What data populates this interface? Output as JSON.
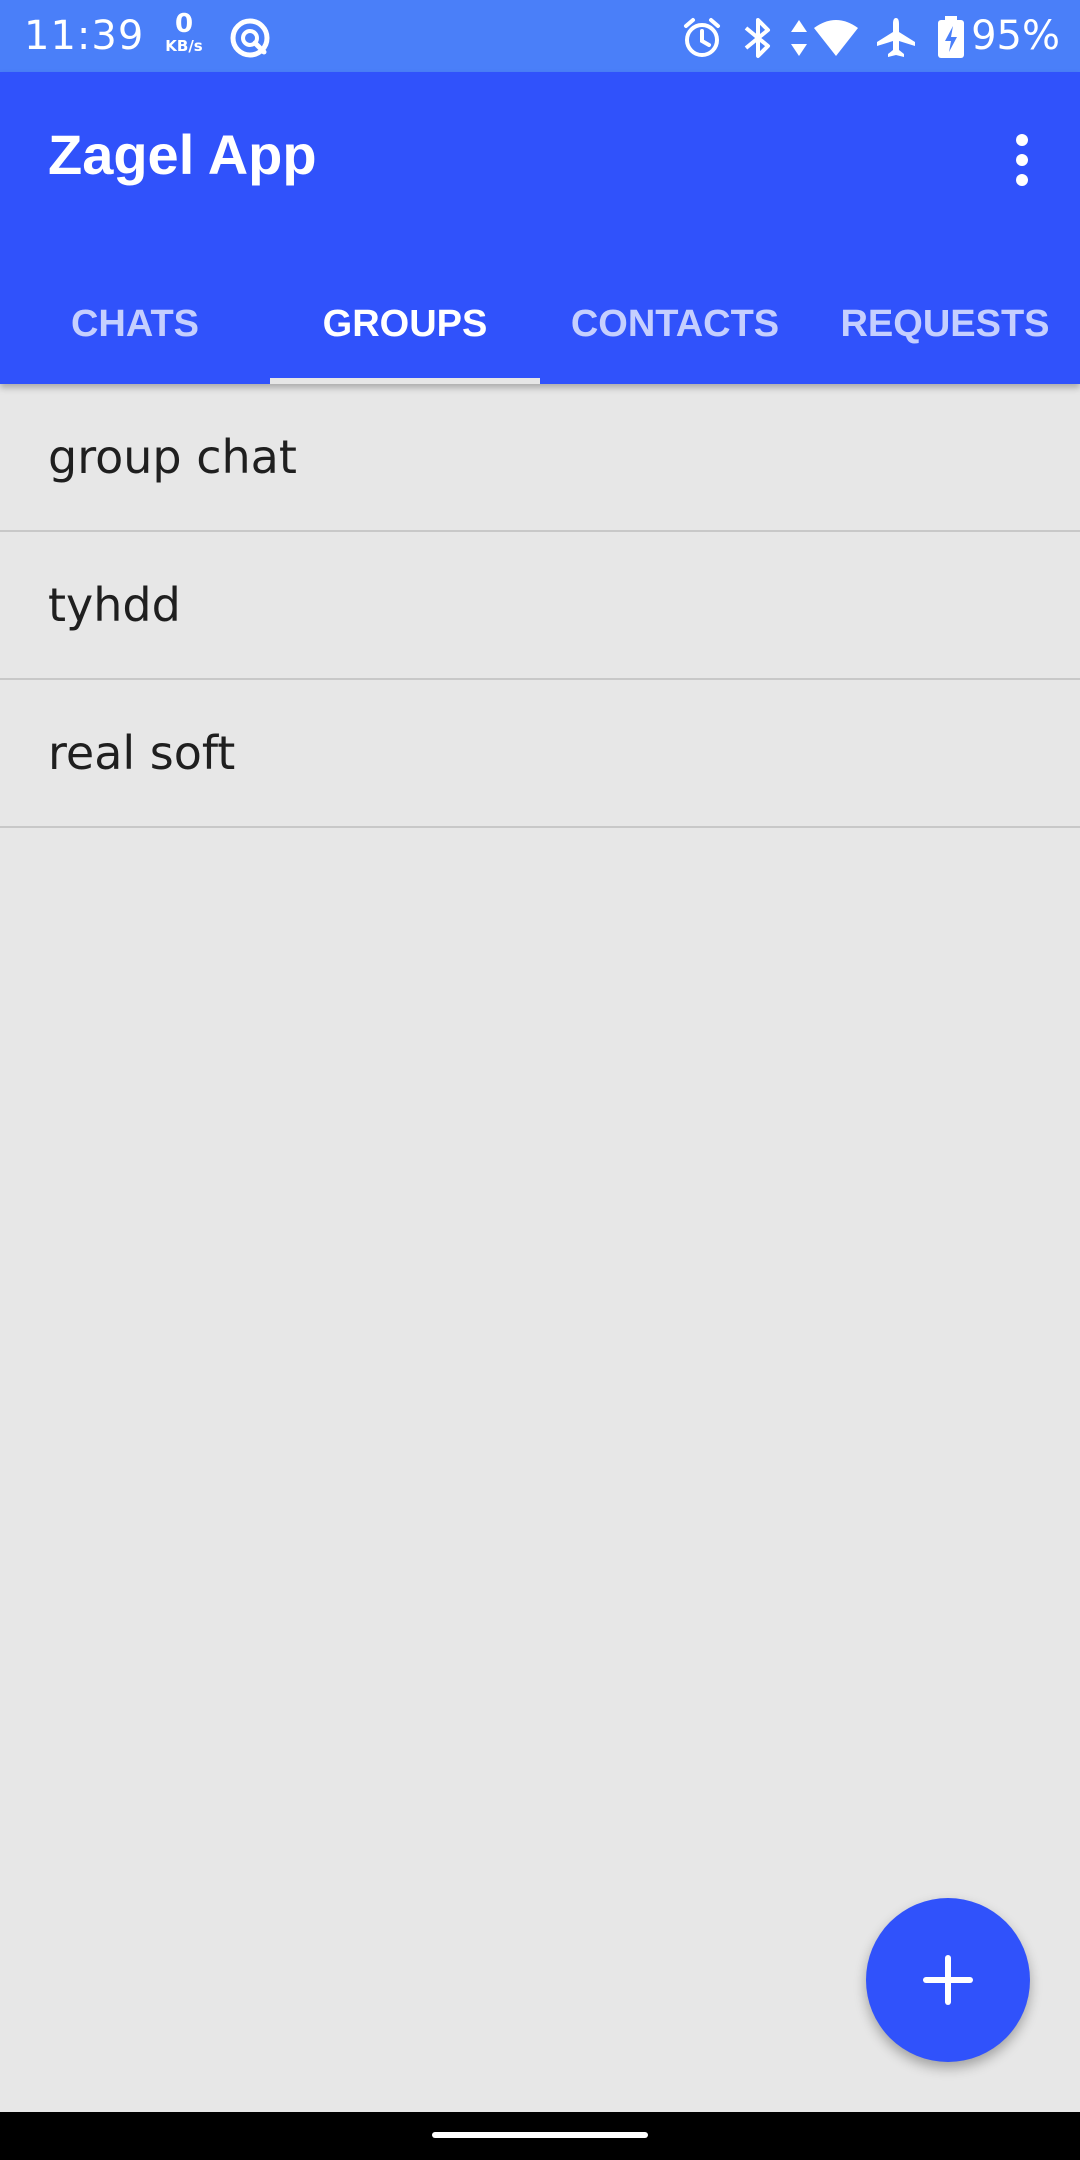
{
  "status_bar": {
    "time": "11:39",
    "net_speed_value": "0",
    "net_speed_unit": "KB/s",
    "battery_percent": "95%",
    "icons": [
      "data-saver-icon",
      "alarm-icon",
      "bluetooth-icon",
      "data-arrows-icon",
      "wifi-icon",
      "airplane-mode-icon",
      "battery-charging-icon"
    ]
  },
  "app_bar": {
    "title": "Zagel App",
    "overflow_icon": "more-vert-icon"
  },
  "tabs": [
    {
      "label": "CHATS",
      "selected": false
    },
    {
      "label": "GROUPS",
      "selected": true
    },
    {
      "label": "CONTACTS",
      "selected": false
    },
    {
      "label": "REQUESTS",
      "selected": false
    }
  ],
  "groups": [
    {
      "name": "group chat"
    },
    {
      "name": "tyhdd"
    },
    {
      "name": "real soft"
    }
  ],
  "fab": {
    "icon": "plus-icon"
  },
  "colors": {
    "status_bar": "#4a7ff9",
    "primary": "#3052fb",
    "background": "#e7e7e7",
    "divider": "#c8c8c8",
    "text": "#1f1f1f"
  }
}
